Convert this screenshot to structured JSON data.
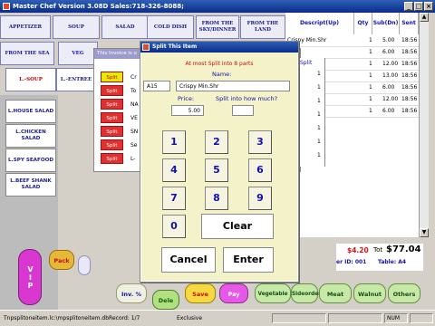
{
  "title": "Master Chef Version 3.08D Sales:718-326-8088;",
  "window_controls": [
    "_",
    "□",
    "×"
  ],
  "categories": [
    {
      "label": "APPETIZER"
    },
    {
      "label": "SOUP"
    },
    {
      "label": "SALAD"
    },
    {
      "label": "COLD DISH"
    },
    {
      "label": "FROM THE SKY/DINNER"
    },
    {
      "label": "FROM THE LAND"
    },
    {
      "label": "FROM THE SEA"
    },
    {
      "label": "VEG"
    },
    {
      "label": "L.-SOUP"
    },
    {
      "label": "L.-ENTREE"
    }
  ],
  "left_items": [
    {
      "label": "L.HOUSE SALAD"
    },
    {
      "label": "L.CHICKEN SALAD"
    },
    {
      "label": "L.SPY SEAFOOD"
    },
    {
      "label": "L.BEEF SHANK SALAD"
    }
  ],
  "invoice_window": {
    "title": "This Invoice is o",
    "split_label": "Split",
    "split_header": "Split",
    "rows": [
      {
        "text": "Cr",
        "split_no": "1"
      },
      {
        "text": "To",
        "split_no": "1"
      },
      {
        "text": "NA",
        "split_no": "1"
      },
      {
        "text": "VE",
        "split_no": "1"
      },
      {
        "text": "SN",
        "split_no": "1"
      },
      {
        "text": "Se",
        "split_no": "1"
      },
      {
        "text": "L-",
        "split_no": "1"
      }
    ]
  },
  "order_table": {
    "headers": [
      "Descript(Up)",
      "Qty",
      "Sub(Dn)",
      "Sent"
    ],
    "rows": [
      {
        "desc": "Crispy Min.Shr",
        "qty": "1",
        "sub": "5.00",
        "sent": "18:56"
      },
      {
        "desc": "",
        "qty": "1",
        "sub": "6.00",
        "sent": "18:56"
      },
      {
        "desc": "",
        "qty": "1",
        "sub": "12.00",
        "sent": "18:56"
      },
      {
        "desc": "",
        "qty": "1",
        "sub": "13.00",
        "sent": "18:56"
      },
      {
        "desc": "",
        "qty": "1",
        "sub": "6.00",
        "sent": "18:56"
      },
      {
        "desc": "",
        "qty": "1",
        "sub": "12.00",
        "sent": "18:56"
      },
      {
        "desc": "Al",
        "qty": "1",
        "sub": "6.00",
        "sent": "18:56"
      }
    ]
  },
  "split_dialog": {
    "title": "Split This Item",
    "note": "At most Split into 8 parts",
    "name_label": "Name:",
    "item_code": "A15",
    "item_name": "Crispy Min.Shr",
    "price_label": "Price:",
    "price_value": "5.00",
    "split_into_label": "Split into how much?",
    "split_into_value": "",
    "keys": [
      "1",
      "2",
      "3",
      "4",
      "5",
      "6",
      "7",
      "8",
      "9",
      "0"
    ],
    "clear_label": "Clear",
    "cancel_label": "Cancel",
    "enter_label": "Enter"
  },
  "totals": {
    "tax": "$4.20",
    "total_label": "Tot",
    "total": "$77.04",
    "er_id": "er ID: 001",
    "table": "Table: A4"
  },
  "bottom_buttons": {
    "vip": "VIP",
    "pack": "Pack",
    "inv_pct": "Inv. %",
    "dele": "Dele",
    "save": "Save",
    "pay": "Pay",
    "vegetable": "Vegetable",
    "sideorder": "Sideorder",
    "meat": "Meat",
    "walnut": "Walnut",
    "others": "Others"
  },
  "status": {
    "left": "Tnpsplitoneitem.lc:\\mpsplitoneitem.dbRecord: 1/7",
    "mode": "Exclusive",
    "num": "NUM"
  },
  "colors": {
    "title_bar": "#0a2c8a",
    "split_button": "#e03030",
    "dialog_bg": "#f4f2c8",
    "accent_red": "#d01010",
    "accent_blue": "#1010c0"
  }
}
